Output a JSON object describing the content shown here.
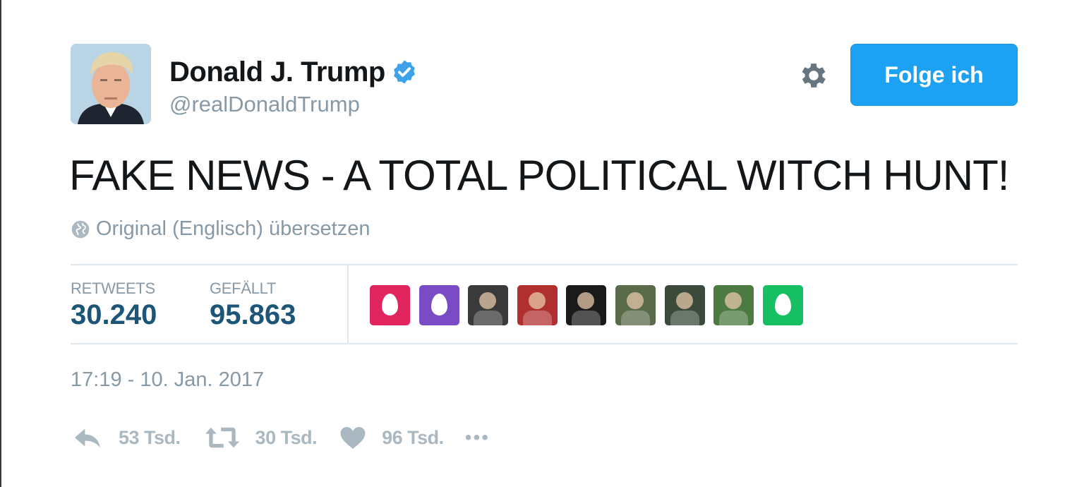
{
  "user": {
    "fullname": "Donald J. Trump",
    "handle": "@realDonaldTrump",
    "verified": true
  },
  "follow_button": {
    "label": "Folge ich"
  },
  "tweet": {
    "text": "FAKE NEWS - A TOTAL POLITICAL WITCH HUNT!",
    "translate_label": "Original (Englisch) übersetzen",
    "timestamp": "17:19 - 10. Jan. 2017"
  },
  "stats": {
    "retweets_label": "RETWEETS",
    "retweets_value": "30.240",
    "likes_label": "GEFÄLLT",
    "likes_value": "95.863"
  },
  "liker_avatars": [
    {
      "kind": "egg",
      "color": "#e0245e"
    },
    {
      "kind": "egg",
      "color": "#794bc4"
    },
    {
      "kind": "photo",
      "color": "#3a3a3a"
    },
    {
      "kind": "photo",
      "color": "#b03030"
    },
    {
      "kind": "photo",
      "color": "#1a1a1a"
    },
    {
      "kind": "photo",
      "color": "#5a6b4a"
    },
    {
      "kind": "photo",
      "color": "#3b4a3a"
    },
    {
      "kind": "photo",
      "color": "#4d7a40"
    },
    {
      "kind": "egg",
      "color": "#17bf63"
    }
  ],
  "actions": {
    "reply_count": "53 Tsd.",
    "retweet_count": "30 Tsd.",
    "like_count": "96 Tsd.",
    "more_label": "•••"
  },
  "colors": {
    "accent": "#1da1f2",
    "stat_value": "#1c5578",
    "muted": "#8899a6",
    "action_gray": "#aab8c2"
  }
}
